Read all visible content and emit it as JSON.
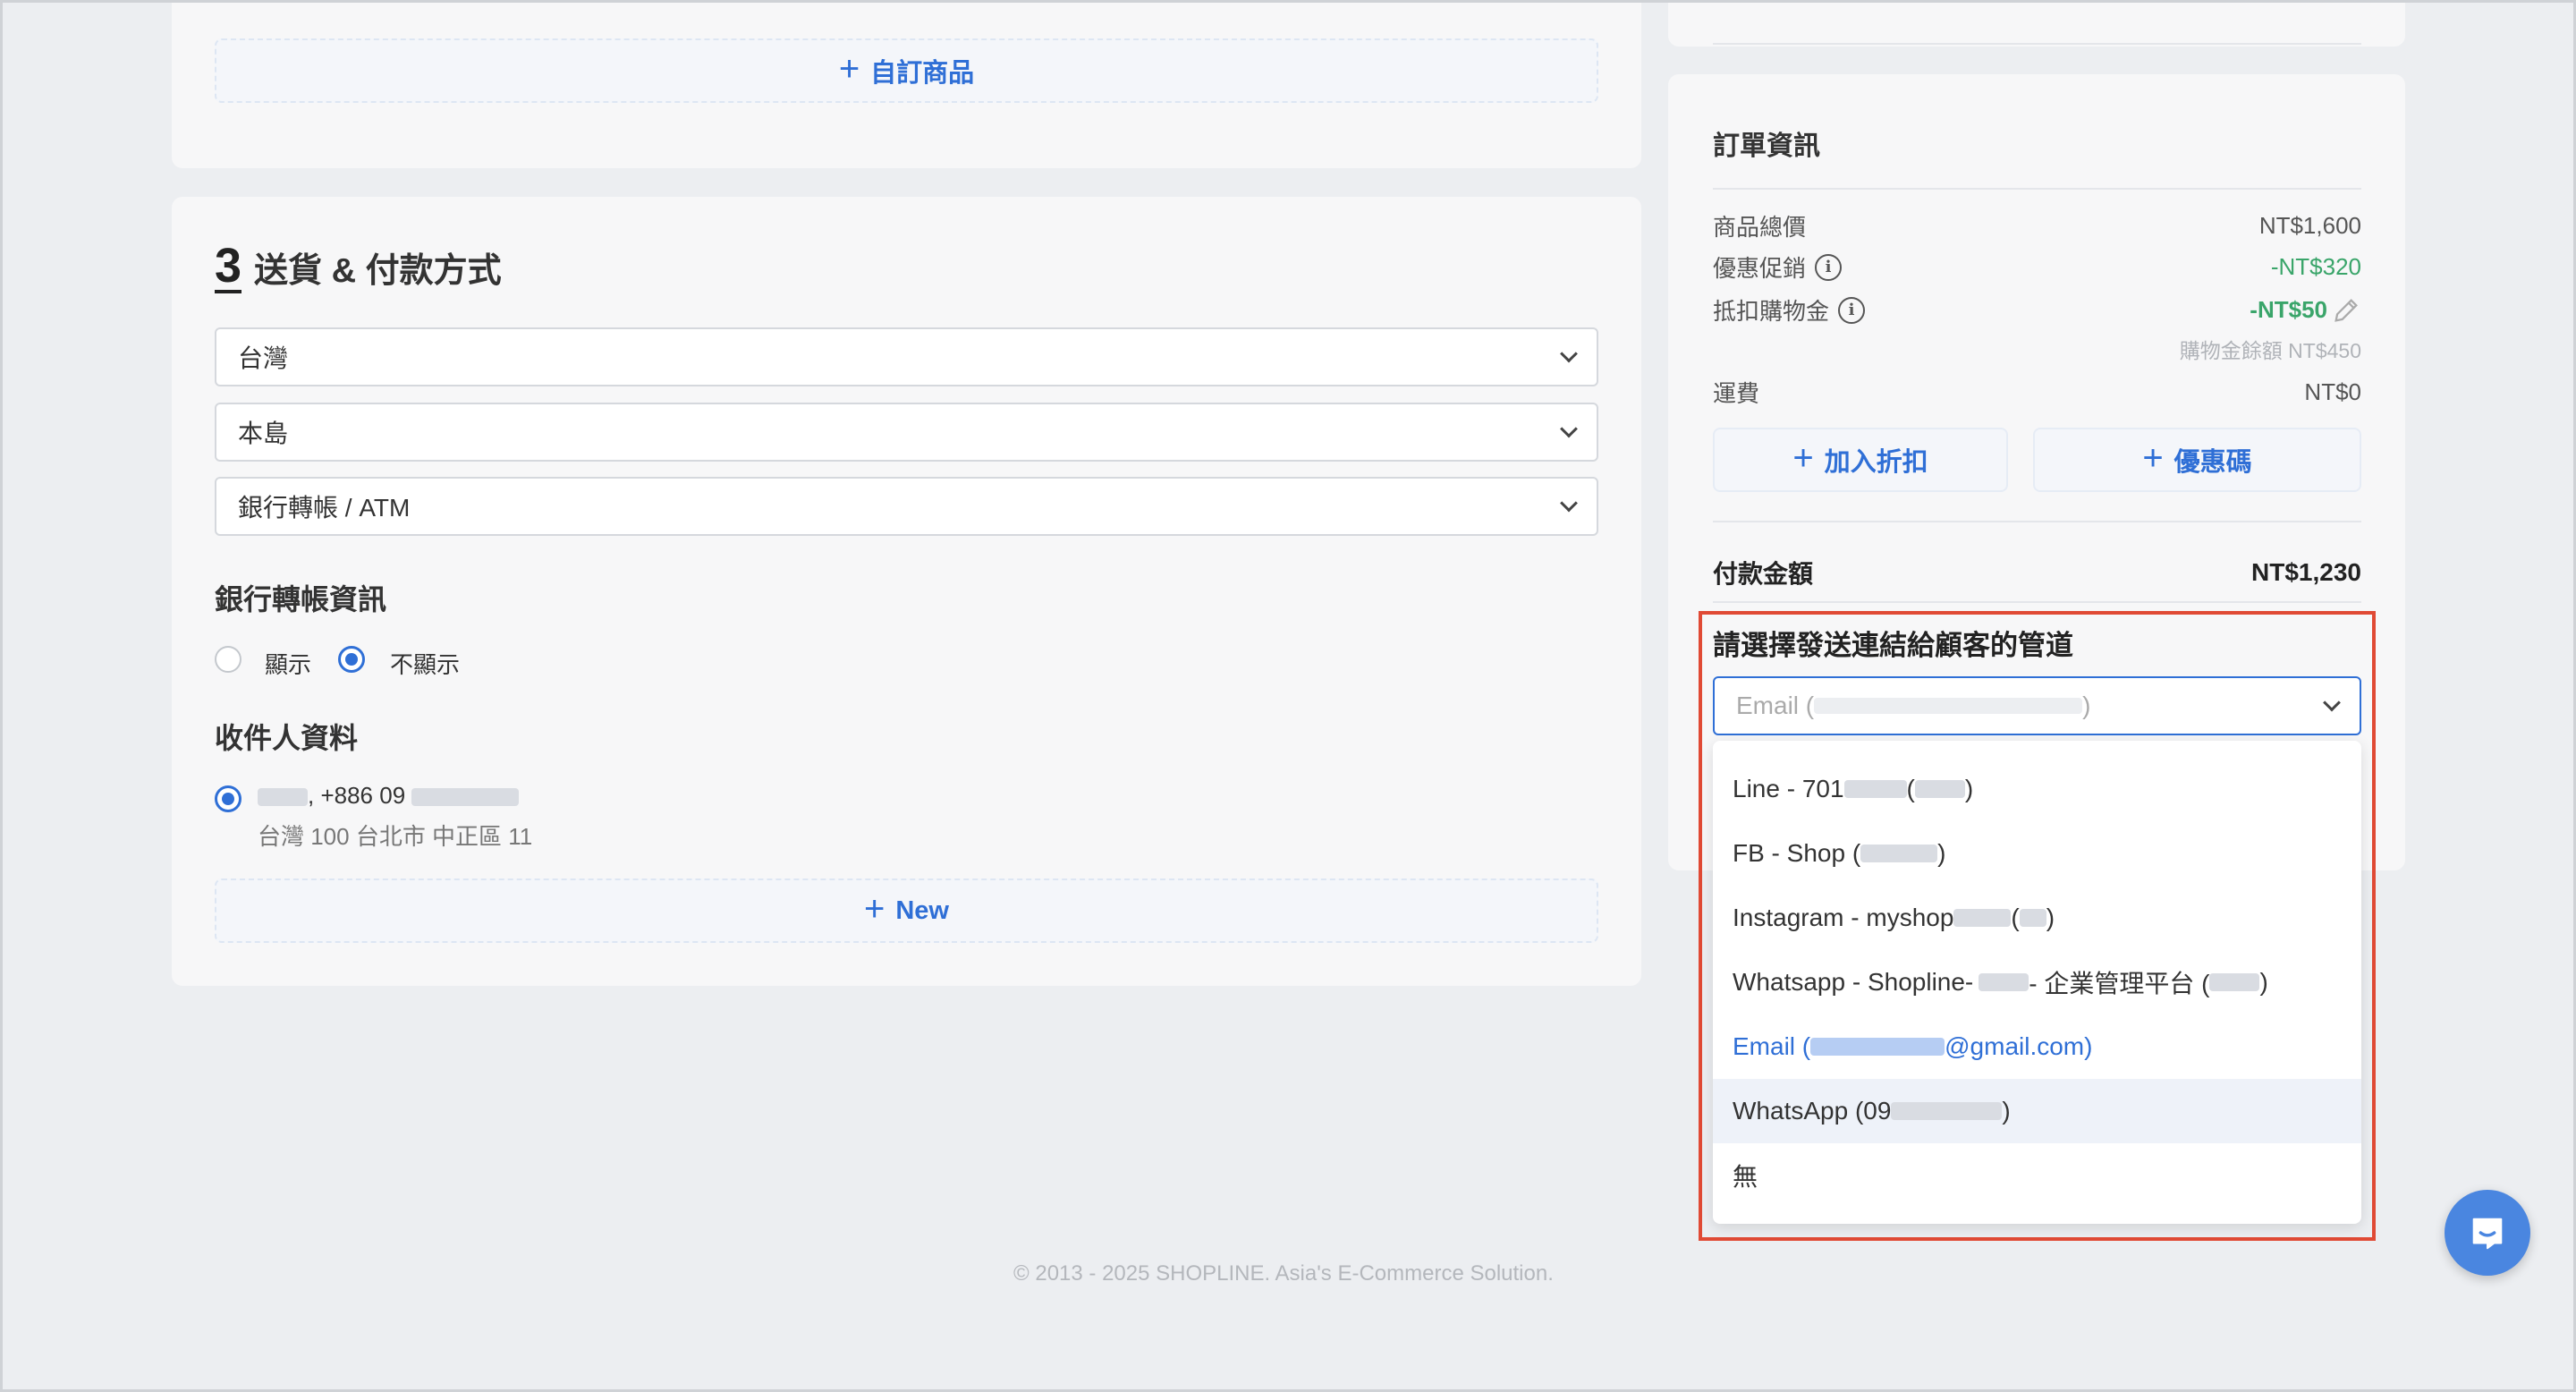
{
  "left": {
    "custom_product_label": "自訂商品",
    "section_number": "3",
    "section_title": "送貨 & 付款方式",
    "country_select": "台灣",
    "region_select": "本島",
    "payment_select": "銀行轉帳 / ATM",
    "bank_info_title": "銀行轉帳資訊",
    "radio_show": "顯示",
    "radio_hide": "不顯示",
    "recipient_title": "收件人資料",
    "recipient_phone": ", +886 09",
    "recipient_address": "台灣 100 台北市 中正區 11",
    "new_label": "New"
  },
  "order": {
    "title": "訂單資訊",
    "subtotal_label": "商品總價",
    "subtotal_value": "NT$1,600",
    "promo_label": "優惠促銷",
    "promo_value": "-NT$320",
    "credit_label": "抵扣購物金",
    "credit_value": "-NT$50",
    "credit_balance": "購物金餘額 NT$450",
    "shipping_label": "運費",
    "shipping_value": "NT$0",
    "add_discount": "加入折扣",
    "coupon": "優惠碼",
    "total_label": "付款金額",
    "total_value": "NT$1,230"
  },
  "channel": {
    "title": "請選擇發送連結給顧客的管道",
    "selected_prefix": "Email (",
    "selected_suffix": ")",
    "options": [
      {
        "prefix": "Line - 701",
        "mid": " (",
        "suffix": ")"
      },
      {
        "prefix": "FB - Shop (",
        "mid": "",
        "suffix": ")"
      },
      {
        "prefix": "Instagram - myshop",
        "mid": " (",
        "suffix": ")"
      },
      {
        "prefix": "Whatsapp - Shopline-",
        "mid": " - 企業管理平台 (",
        "suffix": ")"
      },
      {
        "prefix": "Email (",
        "mid": "",
        "suffix": "@gmail.com)"
      },
      {
        "prefix": "WhatsApp (09",
        "mid": "",
        "suffix": ")"
      },
      {
        "prefix": "無",
        "mid": "",
        "suffix": ""
      }
    ]
  },
  "footer": {
    "copyright": "© 2013 - 2025 SHOPLINE. Asia's E-Commerce Solution."
  },
  "colors": {
    "accent": "#2f6fd6",
    "discount_green": "#3aa56a",
    "highlight_red": "#e04a35",
    "chat_button": "#4a86e0"
  },
  "icons": {
    "chat": "chat-bubble-icon",
    "info": "info-icon",
    "edit": "pencil-icon",
    "plus": "plus-icon",
    "dropdown": "chevron-down-icon"
  }
}
